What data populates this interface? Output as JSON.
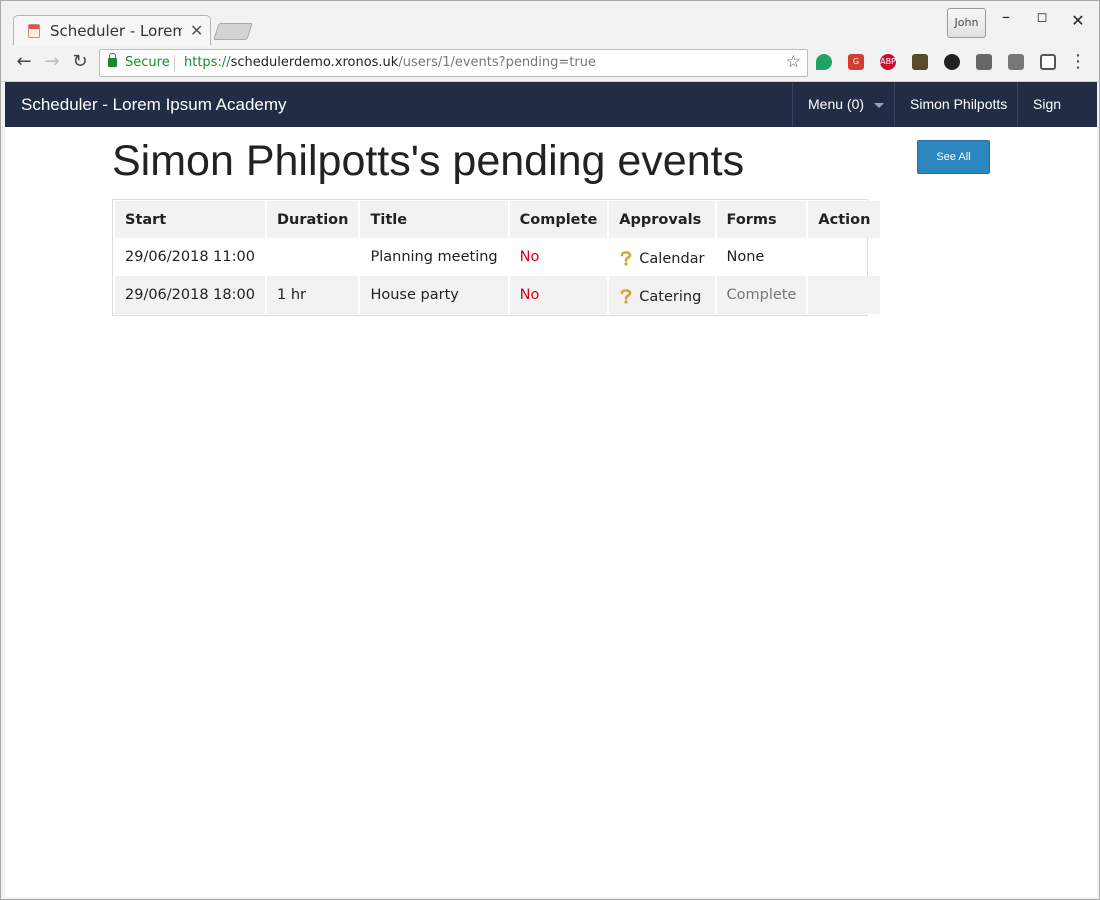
{
  "browser": {
    "tab_title": "Scheduler - Lorem Ipsum Academy",
    "profile_name": "John",
    "secure_label": "Secure",
    "url_scheme": "https://",
    "url_host": "schedulerdemo.xronos.uk",
    "url_path": "/users/1/events?pending=true"
  },
  "navbar": {
    "brand": "Scheduler - Lorem Ipsum Academy",
    "menu_label": "Menu (0)",
    "user_name": "Simon Philpotts",
    "signout_label": "Sign out",
    "background_color": "#222c44"
  },
  "page": {
    "title": "Simon Philpotts's pending events",
    "see_all_label": "See All",
    "button_color": "#2e86be"
  },
  "table": {
    "headers": [
      "Start",
      "Duration",
      "Title",
      "Complete",
      "Approvals",
      "Forms",
      "Action"
    ],
    "rows": [
      {
        "start": "29/06/2018 11:00",
        "duration": "",
        "title": "Planning meeting",
        "complete": "No",
        "approvals": "Calendar",
        "forms": "None",
        "action": ""
      },
      {
        "start": "29/06/2018 18:00",
        "duration": "1 hr",
        "title": "House party",
        "complete": "No",
        "approvals": "Catering",
        "forms": "Complete",
        "action": ""
      }
    ]
  },
  "icons": {
    "approval_status": "question-mark-icon"
  },
  "colors": {
    "no_value": "#d9001b",
    "secure": "#1b8a2e"
  }
}
